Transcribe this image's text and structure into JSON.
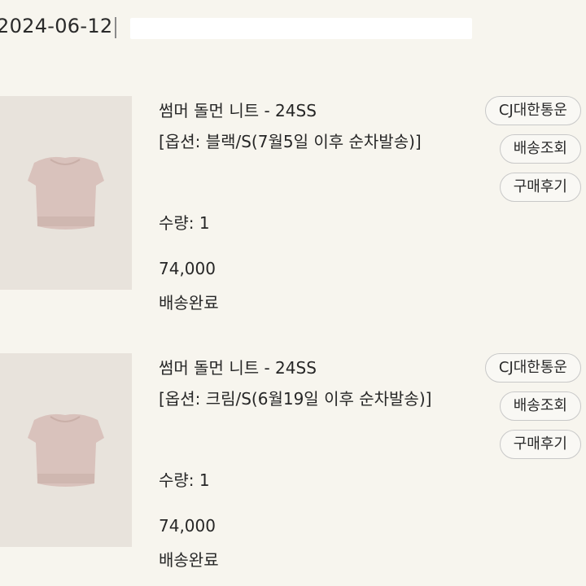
{
  "order": {
    "date": "2024-06-12"
  },
  "products": [
    {
      "title": "썸머 돌먼 니트 - 24SS",
      "option": "[옵션: 블랙/S(7월5일 이후 순차발송)]",
      "quantity": "수량: 1",
      "price": "74,000",
      "status": "배송완료",
      "buttons": {
        "carrier": "CJ대한통운",
        "track": "배송조회",
        "review": "구매후기"
      }
    },
    {
      "title": "썸머 돌먼 니트 - 24SS",
      "option": "[옵션: 크림/S(6월19일 이후 순차발송)]",
      "quantity": "수량: 1",
      "price": "74,000",
      "status": "배송완료",
      "buttons": {
        "carrier": "CJ대한통운",
        "track": "배송조회",
        "review": "구매후기"
      }
    }
  ],
  "colors": {
    "background": "#f7f5ee",
    "thumb_bg": "#e8e3dc",
    "knit_color": "#d9c2bc",
    "button_border": "#c8c8c8"
  }
}
